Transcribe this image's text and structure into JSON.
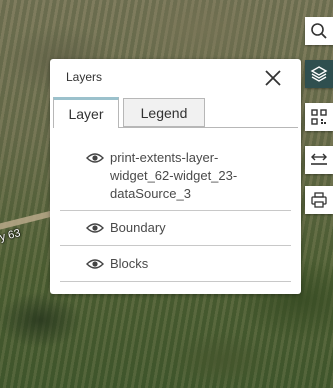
{
  "map": {
    "road_label": "y 63"
  },
  "panel": {
    "title": "Layers",
    "tabs": [
      {
        "label": "Layer",
        "active": true
      },
      {
        "label": "Legend",
        "active": false
      }
    ],
    "layers": [
      {
        "label_lines": [
          "print-extents-layer-",
          "widget_62-widget_23-",
          "dataSource_3"
        ],
        "icon": "eye-icon"
      },
      {
        "label": "Boundary",
        "icon": "eye-icon"
      },
      {
        "label": "Blocks",
        "icon": "eye-icon"
      }
    ]
  },
  "toolbar": {
    "tools": [
      {
        "name": "search-icon",
        "active": false
      },
      {
        "name": "layers-icon",
        "active": true
      },
      {
        "name": "qr-code-icon",
        "active": false
      },
      {
        "name": "swipe-icon",
        "active": false
      },
      {
        "name": "print-icon",
        "active": false
      }
    ],
    "active_color": "#2f4f4f"
  }
}
